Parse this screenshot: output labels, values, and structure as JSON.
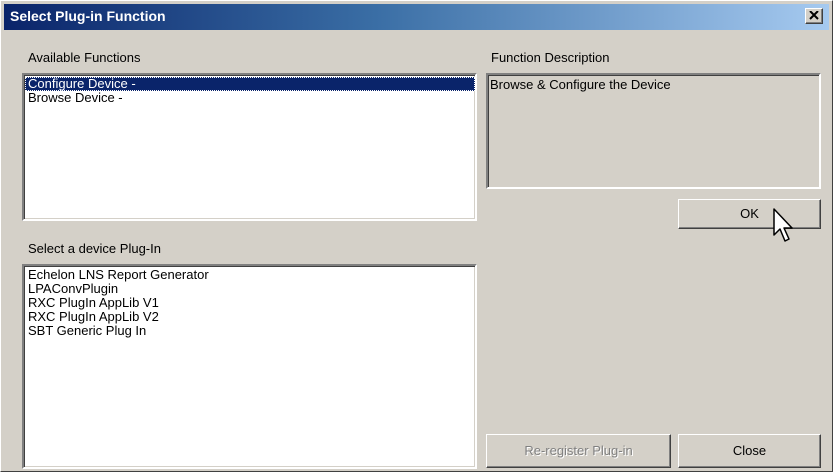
{
  "window": {
    "title": "Select Plug-in Function"
  },
  "functions": {
    "label": "Available Functions",
    "items": [
      {
        "label": "Configure Device -",
        "selected": true
      },
      {
        "label": "Browse Device -",
        "selected": false
      }
    ]
  },
  "description": {
    "label": "Function Description",
    "text": "Browse & Configure the Device"
  },
  "plugins": {
    "label": "Select a device Plug-In",
    "items": [
      {
        "label": "Echelon LNS Report Generator"
      },
      {
        "label": "LPAConvPlugin"
      },
      {
        "label": "RXC PlugIn AppLib V1"
      },
      {
        "label": "RXC PlugIn AppLib V2"
      },
      {
        "label": "SBT Generic Plug In"
      }
    ]
  },
  "buttons": {
    "ok": "OK",
    "reregister": "Re-register Plug-in",
    "close": "Close"
  },
  "colors": {
    "titlebar_start": "#0a246a",
    "titlebar_end": "#a6caf0",
    "selection": "#0a246a",
    "face": "#d4d0c8"
  },
  "icons": {
    "close": "close-icon",
    "cursor": "mouse-pointer-icon"
  }
}
